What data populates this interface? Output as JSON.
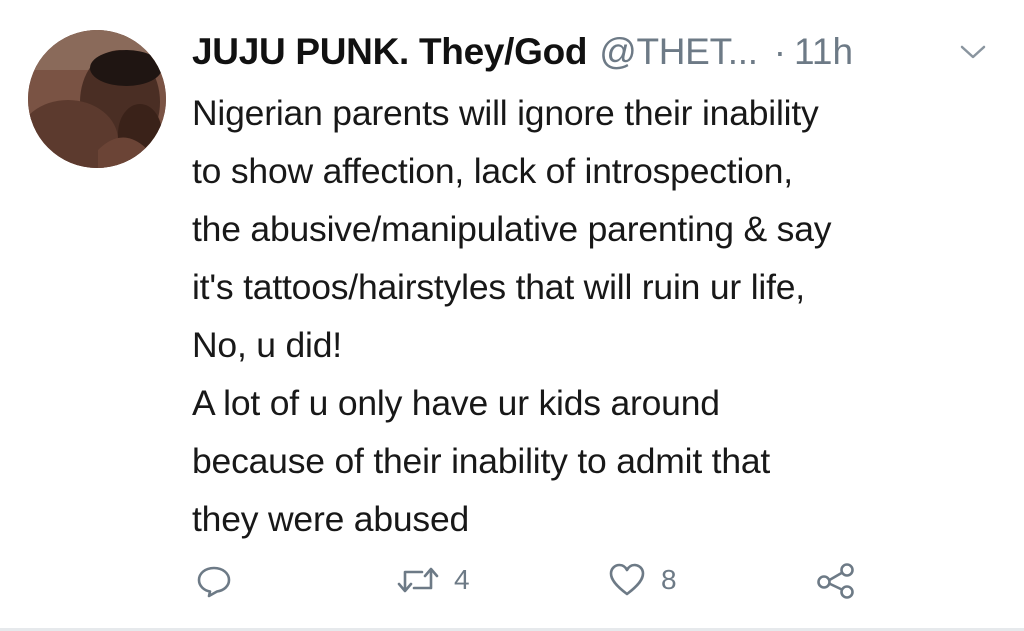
{
  "tweet": {
    "display_name": "JUJU PUNK. They/God",
    "handle": "@THET...",
    "separator": "·",
    "time": "11h",
    "text_lines": [
      "Nigerian parents will ignore their inability",
      "to show affection, lack of introspection,",
      "the abusive/manipulative parenting & say",
      "it's tattoos/hairstyles that will ruin ur life,",
      "No, u did!",
      "A lot of u only have ur kids around",
      "because of their inability to admit that",
      "they were abused"
    ],
    "actions": {
      "reply_icon": "reply-icon",
      "retweet_icon": "retweet-icon",
      "retweet_count": "4",
      "like_icon": "heart-icon",
      "like_count": "8",
      "share_icon": "share-icon"
    },
    "colors": {
      "text": "#181818",
      "muted": "#6d7a86"
    }
  }
}
